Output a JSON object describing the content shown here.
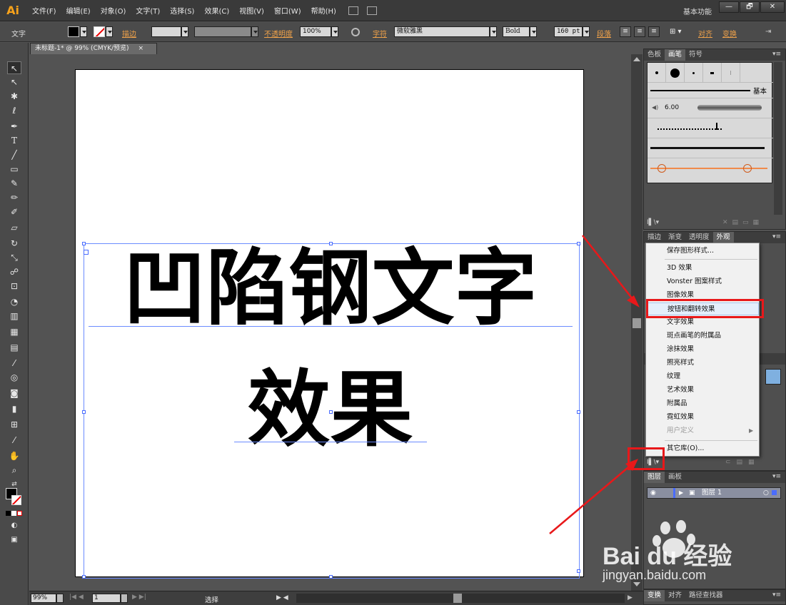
{
  "app": {
    "logo": "Ai",
    "workspace": "基本功能"
  },
  "menu": [
    "文件(F)",
    "编辑(E)",
    "对象(O)",
    "文字(T)",
    "选择(S)",
    "效果(C)",
    "视图(V)",
    "窗口(W)",
    "帮助(H)"
  ],
  "window_controls": {
    "minimize": "—",
    "restore": "🗗",
    "close": "✕"
  },
  "controlbar": {
    "tool_label": "文字",
    "stroke_label": "描边",
    "opacity_label": "不透明度",
    "opacity_value": "100%",
    "char_label": "字符",
    "font_name": "微软雅黑",
    "font_style": "Bold",
    "font_size": "160 pt",
    "para_label": "段落",
    "align_label": "对齐",
    "transform_label": "变换"
  },
  "document": {
    "tab_title": "未标题-1* @ 99% (CMYK/预览)",
    "tab_close": "×"
  },
  "artboard": {
    "line1": "凹陷钢文字",
    "line2": "效果"
  },
  "statusbar": {
    "zoom": "99%",
    "page": "1",
    "status": "选择"
  },
  "brush_panel": {
    "tabs": [
      "色板",
      "画笔",
      "符号"
    ],
    "active_tab": "画笔",
    "basic_label": "基本",
    "size_value": "6.00"
  },
  "appearance_panel": {
    "tabs": [
      "描边",
      "渐变",
      "透明度",
      "外观"
    ],
    "active_tab": "外观"
  },
  "graphic_styles_menu": {
    "items": [
      {
        "label": "保存图形样式...",
        "disabled": false
      },
      {
        "label": "3D 效果",
        "disabled": false
      },
      {
        "label": "Vonster 图案样式",
        "disabled": false
      },
      {
        "label": "图像效果",
        "disabled": false
      },
      {
        "label": "按钮和翻转效果",
        "disabled": false,
        "highlighted": true
      },
      {
        "label": "文字效果",
        "disabled": false
      },
      {
        "label": "斑点画笔的附属品",
        "disabled": false
      },
      {
        "label": "涂抹效果",
        "disabled": false
      },
      {
        "label": "照亮样式",
        "disabled": false
      },
      {
        "label": "纹理",
        "disabled": false
      },
      {
        "label": "艺术效果",
        "disabled": false
      },
      {
        "label": "附属品",
        "disabled": false
      },
      {
        "label": "霓虹效果",
        "disabled": false
      },
      {
        "label": "用户定义",
        "disabled": true
      },
      {
        "label": "其它库(O)...",
        "disabled": false
      }
    ]
  },
  "layers_panel": {
    "tabs": [
      "图层",
      "画板"
    ],
    "active_tab": "图层",
    "layer_name": "图层 1"
  },
  "bottom_panel": {
    "tabs": [
      "变换",
      "对齐",
      "路径查找器"
    ]
  },
  "watermark": {
    "brand": "Bai du 经验",
    "url": "jingyan.baidu.com"
  },
  "colors": {
    "accent_orange": "#f0a24a",
    "highlight_red": "#e8181a",
    "selection_blue": "#4a6cff"
  }
}
